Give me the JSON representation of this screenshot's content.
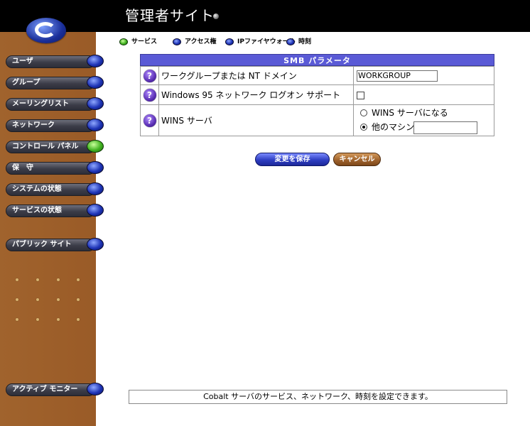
{
  "app": {
    "title": "管理者サイト"
  },
  "sidebar": {
    "items": [
      {
        "label": "ユーザ",
        "active": false
      },
      {
        "label": "グループ",
        "active": false
      },
      {
        "label": "メーリングリスト",
        "active": false
      },
      {
        "label": "ネットワーク",
        "active": false
      },
      {
        "label": "コントロール パネル",
        "active": true
      },
      {
        "label": "保　守",
        "active": false
      },
      {
        "label": "システムの状態",
        "active": false
      },
      {
        "label": "サービスの状態",
        "active": false
      }
    ],
    "public_site": "パブリック サイト",
    "active_monitor": "アクティブ モニター"
  },
  "tabs": [
    {
      "label": "サービス",
      "active": true
    },
    {
      "label": "アクセス権",
      "active": false
    },
    {
      "label": "IPファイヤウォール",
      "active": false
    },
    {
      "label": "時刻",
      "active": false
    }
  ],
  "smb": {
    "header": "SMB パラメータ",
    "rows": {
      "workgroup": {
        "label": "ワークグループまたは NT ドメイン",
        "value": "WORKGROUP"
      },
      "logon": {
        "label": "Windows 95 ネットワーク ログオン サポート",
        "checked": false
      },
      "wins": {
        "label": "WINS サーバ",
        "option_server": "WINS サーバになる",
        "option_other": "他のマシン:",
        "selected": "other",
        "other_value": ""
      }
    }
  },
  "buttons": {
    "save": "変更を保存",
    "cancel": "キャンセル"
  },
  "status": "Cobalt サーバのサービス、ネットワーク、時刻を設定できます。",
  "colors": {
    "sidebar": "#9d5e2a",
    "header": "#000000",
    "table_header": "#5a5ad6"
  }
}
